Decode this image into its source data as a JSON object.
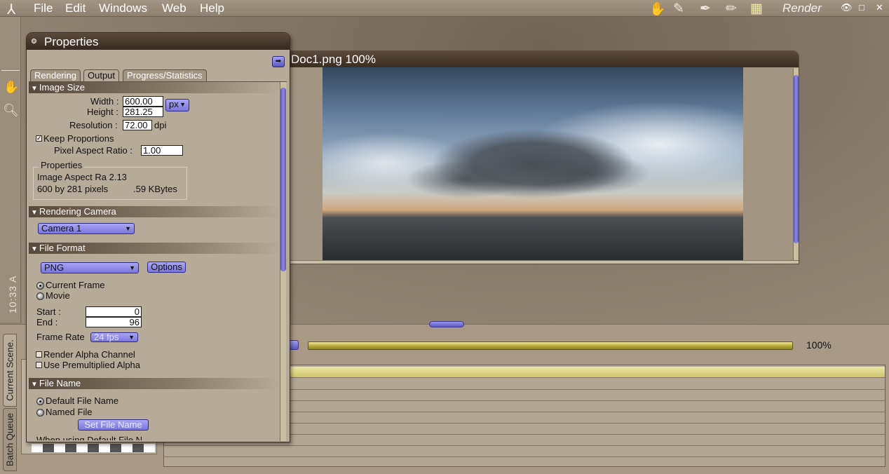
{
  "menubar": {
    "items": [
      "File",
      "Edit",
      "Windows",
      "Web",
      "Help"
    ],
    "render_label": "Render",
    "tools": [
      "hand-tool-icon",
      "brush-tool-icon",
      "pen-tool-icon",
      "pencil-tool-icon",
      "film-icon"
    ],
    "window_controls": [
      "eye-icon",
      "restore-icon",
      "close-icon"
    ]
  },
  "left_strip": {
    "tools": [
      "hand-icon",
      "magnifier-icon"
    ],
    "clock": "10:33 A"
  },
  "document": {
    "title": "Doc1.png 100%"
  },
  "properties": {
    "title": "Properties",
    "tabs": [
      "Rendering",
      "Output",
      "Progress/Statistics"
    ],
    "active_tab": "Output",
    "image_size": {
      "header": "Image Size",
      "width_label": "Width :",
      "width_value": "600.00",
      "height_label": "Height :",
      "height_value": "281.25",
      "unit": "px",
      "resolution_label": "Resolution :",
      "resolution_value": "72.00",
      "resolution_unit": "dpi",
      "keep_proportions_label": "Keep Proportions",
      "keep_proportions_checked": true,
      "pixel_aspect_label": "Pixel Aspect Ratio :",
      "pixel_aspect_value": "1.00",
      "group_label": "Properties",
      "aspect_text": "Image Aspect Ra 2.13",
      "pixels_text": "600 by 281 pixels",
      "size_text": ".59 KBytes"
    },
    "camera": {
      "header": "Rendering Camera",
      "selected": "Camera 1"
    },
    "file_format": {
      "header": "File Format",
      "selected": "PNG",
      "options_label": "Options",
      "current_frame_label": "Current Frame",
      "movie_label": "Movie",
      "start_label": "Start :",
      "start_value": "0",
      "end_label": "End :",
      "end_value": "96",
      "frame_rate_label": "Frame Rate",
      "frame_rate_value": "24 fps",
      "render_alpha_label": "Render Alpha Channel",
      "premultiplied_label": "Use Premultiplied Alpha"
    },
    "file_name": {
      "header": "File Name",
      "default_label": "Default File Name",
      "named_label": "Named File",
      "set_button": "Set File Name",
      "cut_text": "When using Default File N"
    }
  },
  "queue": {
    "side_tabs": [
      "Current Scene.",
      "Batch Queue"
    ],
    "progress_percent": "100%",
    "progress_fraction": 1.0
  }
}
